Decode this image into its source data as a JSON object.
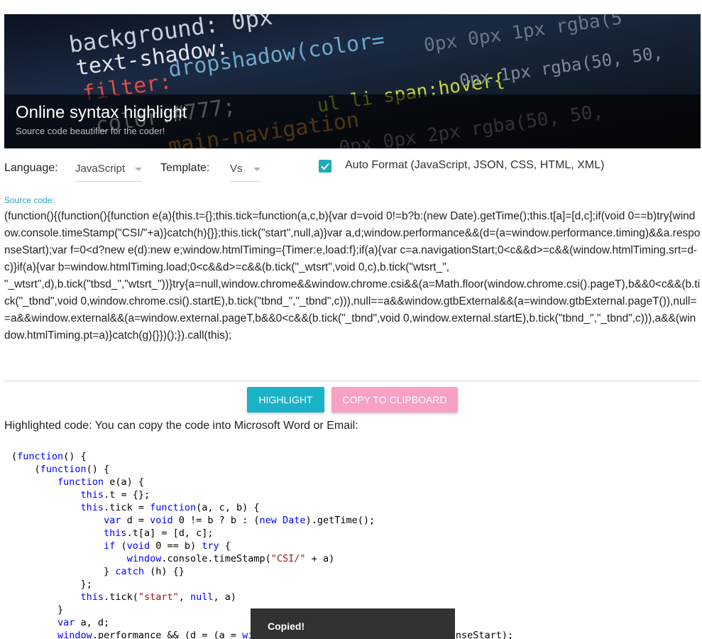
{
  "banner": {
    "title": "Online syntax highlight",
    "subtitle": "Source code beautifier for the coder!"
  },
  "options": {
    "language_label": "Language:",
    "language_value": "JavaScript",
    "template_label": "Template:",
    "template_value": "Vs",
    "auto_format_checked": true,
    "auto_format_label": "Auto Format (JavaScript, JSON, CSS, HTML, XML)"
  },
  "source": {
    "label": "Source code:",
    "text": "(function(){(function(){function e(a){this.t={};this.tick=function(a,c,b){var d=void 0!=b?b:(new Date).getTime();this.t[a]=[d,c];if(void 0==b)try{window.console.timeStamp(\"CSI/\"+a)}catch(h){}};this.tick(\"start\",null,a)}var a,d;window.performance&&(d=(a=window.performance.timing)&&a.responseStart);var f=0<d?new e(d):new e;window.htmlTiming={Timer:e,load:f};if(a){var c=a.navigationStart;0<c&&d>=c&&(window.htmlTiming.srt=d-c)}if(a){var b=window.htmlTiming.load;0<c&&d>=c&&(b.tick(\"_wtsrt\",void 0,c),b.tick(\"wtsrt_\",\n\"_wtsrt\",d),b.tick(\"tbsd_\",\"wtsrt_\"))}try{a=null,window.chrome&&window.chrome.csi&&(a=Math.floor(window.chrome.csi().pageT),b&&0<c&&(b.tick(\"_tbnd\",void 0,window.chrome.csi().startE),b.tick(\"tbnd_\",\"_tbnd\",c))),null==a&&window.gtbExternal&&(a=window.gtbExternal.pageT()),null==a&&window.external&&(a=window.external.pageT,b&&0<c&&(b.tick(\"_tbnd\",void 0,window.external.startE),b.tick(\"tbnd_\",\"_tbnd\",c))),a&&(window.htmlTiming.pt=a)}catch(g){}})();}).call(this);"
  },
  "buttons": {
    "highlight": "HIGHLIGHT",
    "copy": "COPY TO CLIPBOARD"
  },
  "highlighted": {
    "label": "Highlighted code: You can copy the code into Microsoft Word or Email:",
    "lines": [
      "(function() {",
      "    (function() {",
      "        function e(a) {",
      "            this.t = {};",
      "            this.tick = function(a, c, b) {",
      "                var d = void 0 != b ? b : (new Date).getTime();",
      "                this.t[a] = [d, c];",
      "                if (void 0 == b) try {",
      "                    window.console.timeStamp(\"CSI/\" + a)",
      "                } catch (h) {}",
      "            };",
      "            this.tick(\"start\", null, a)",
      "        }",
      "        var a, d;",
      "        window.performance && (d = (a = window.performance.timing) && a.responseStart);"
    ]
  },
  "toast": {
    "text": "Copied!"
  },
  "colors": {
    "accent": "#19b2c7",
    "copy_button": "#f7a1c4",
    "keyword": "#0000ff",
    "string": "#a31515",
    "toast_bg": "#323232"
  }
}
